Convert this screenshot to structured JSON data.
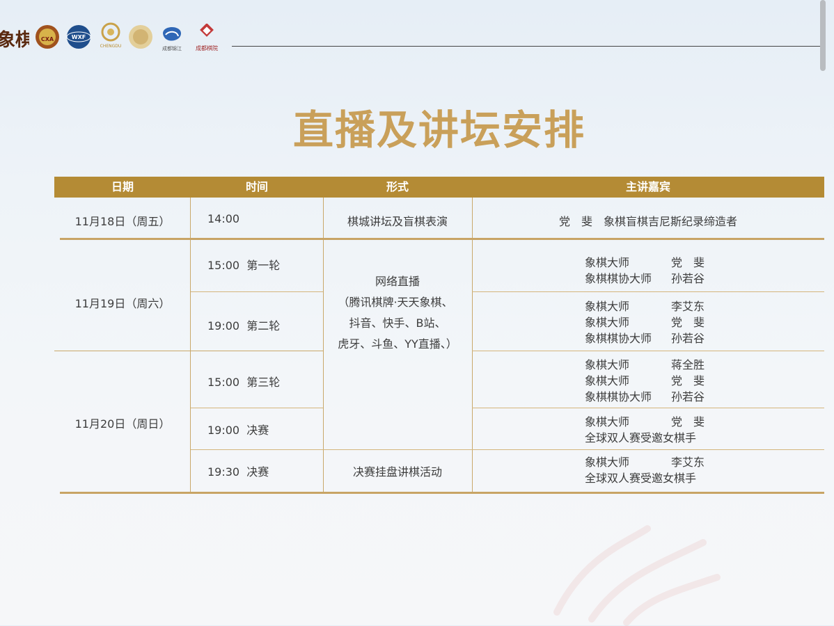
{
  "title": "直播及讲坛安排",
  "logos": [
    {
      "name": "event-logo",
      "text": "象棋"
    },
    {
      "name": "cxa-logo",
      "text": "CXA"
    },
    {
      "name": "wxf-logo",
      "text": "WXF"
    },
    {
      "name": "chengdu-logo",
      "text": "CHENGDU"
    },
    {
      "name": "gold-badge-logo",
      "text": ""
    },
    {
      "name": "jinjiang-logo",
      "text": "成都锦江"
    },
    {
      "name": "chengdu-chess-logo",
      "text": "成都棋院"
    }
  ],
  "table": {
    "headers": [
      "日期",
      "时间",
      "形式",
      "主讲嘉宾"
    ],
    "dates": [
      "11月18日（周五）",
      "11月19日（周六）",
      "11月20日（周日）"
    ],
    "times": [
      "14:00",
      "15:00  第一轮",
      "19:00  第二轮",
      "15:00  第三轮",
      "19:00  决赛",
      "19:30  决赛"
    ],
    "forms": {
      "r1": "棋城讲坛及盲棋表演",
      "live_title": "网络直播",
      "live_l1": "（腾讯棋牌·天天象棋、",
      "live_l2": "抖音、快手、B站、",
      "live_l3": "虎牙、斗鱼、YY直播、）",
      "r6": "决赛挂盘讲棋活动"
    },
    "guest_r1": "党　斐　象棋盲棋吉尼斯纪录缔造者",
    "guests": [
      [
        {
          "t": "象棋大师",
          "n": "党　斐"
        },
        {
          "t": "象棋棋协大师",
          "n": "孙若谷"
        }
      ],
      [
        {
          "t": "象棋大师",
          "n": "李艾东"
        },
        {
          "t": "象棋大师",
          "n": "党　斐"
        },
        {
          "t": "象棋棋协大师",
          "n": "孙若谷"
        }
      ],
      [
        {
          "t": "象棋大师",
          "n": "蒋全胜"
        },
        {
          "t": "象棋大师",
          "n": "党　斐"
        },
        {
          "t": "象棋棋协大师",
          "n": "孙若谷"
        }
      ],
      [
        {
          "t": "象棋大师",
          "n": "党　斐"
        },
        {
          "t": "全球双人赛受邀女棋手",
          "n": ""
        }
      ],
      [
        {
          "t": "象棋大师",
          "n": "李艾东"
        },
        {
          "t": "全球双人赛受邀女棋手",
          "n": ""
        }
      ]
    ]
  }
}
